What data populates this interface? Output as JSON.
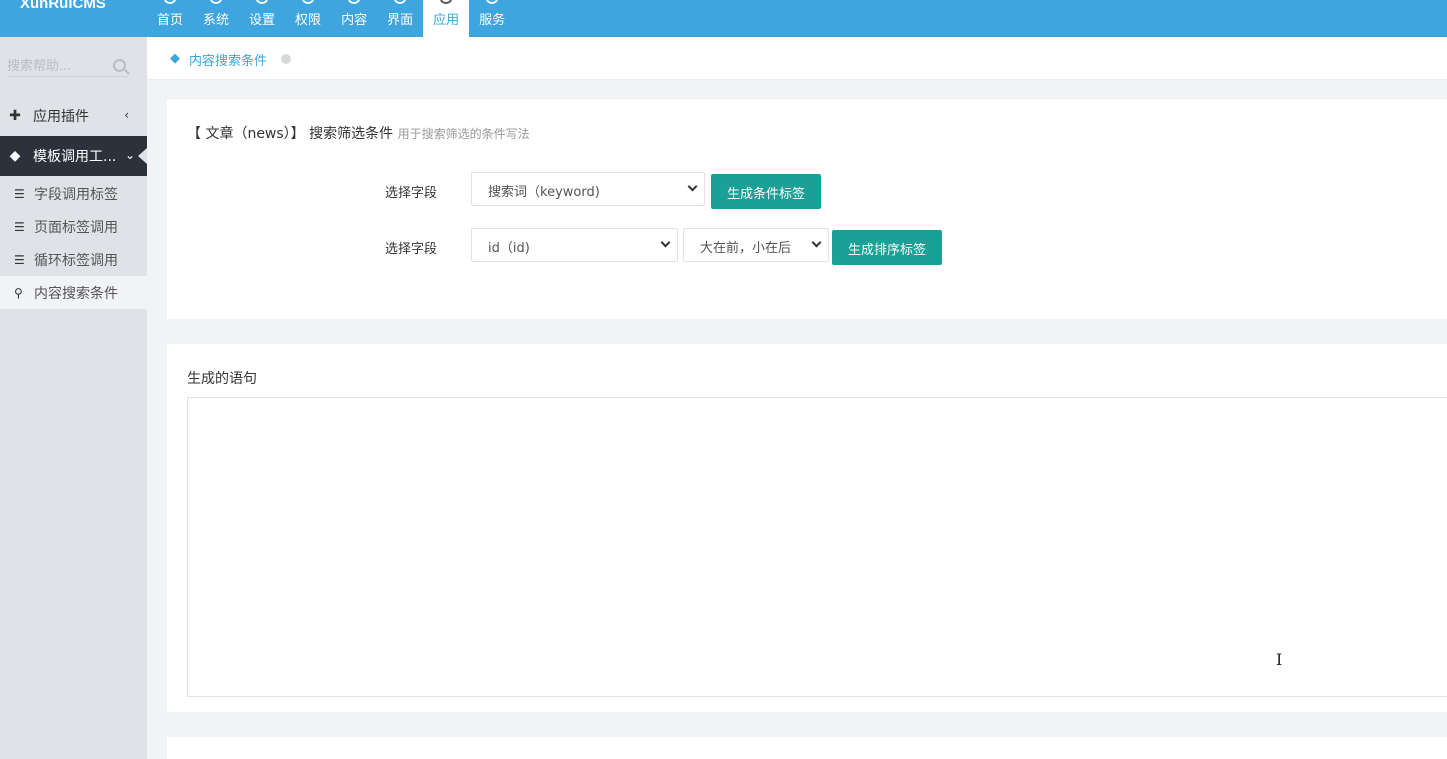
{
  "app": {
    "logo_text": "XunRuiCMS"
  },
  "nav": {
    "items": [
      {
        "label": "首页",
        "icon": "home-icon"
      },
      {
        "label": "系统",
        "icon": "cog-icon"
      },
      {
        "label": "设置",
        "icon": "gears-icon"
      },
      {
        "label": "权限",
        "icon": "user-icon"
      },
      {
        "label": "内容",
        "icon": "content-icon"
      },
      {
        "label": "界面",
        "icon": "ui-icon"
      },
      {
        "label": "应用",
        "icon": "app-icon",
        "active": true
      },
      {
        "label": "服务",
        "icon": "service-icon"
      }
    ]
  },
  "sidebar": {
    "search_placeholder": "搜索帮助...",
    "plugins_label": "应用插件",
    "tpl_label": "模板调用工...",
    "sub_items": [
      "字段调用标签",
      "页面标签调用",
      "循环标签调用",
      "内容搜索条件"
    ]
  },
  "breadcrumb": {
    "text": "内容搜索条件"
  },
  "panel1": {
    "title": "【 文章（news）】 搜索筛选条件",
    "subtitle": "用于搜索筛选的条件写法",
    "row1_label": "选择字段",
    "row1_select": "搜索词（keyword)",
    "row1_button": "生成条件标签",
    "row2_label": "选择字段",
    "row2_select": "id（id)",
    "row2_order": "大在前，小在后",
    "row2_button": "生成排序标签"
  },
  "panel2": {
    "label": "生成的语句",
    "textarea_value": ""
  },
  "colors": {
    "topbar": "#3ea5df",
    "button": "#1aa094",
    "sidebar_active": "#2b323b"
  }
}
